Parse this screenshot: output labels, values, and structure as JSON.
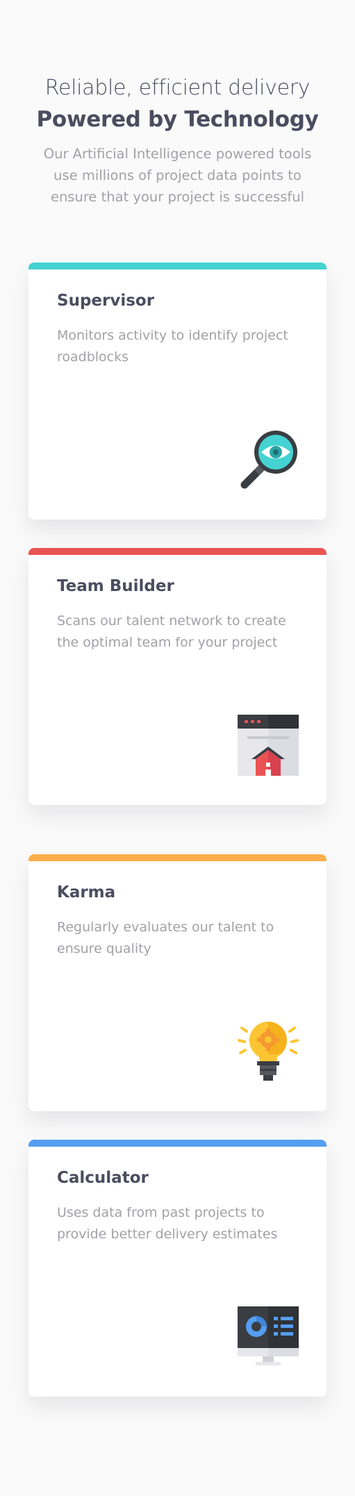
{
  "header": {
    "subtitle": "Reliable, efficient delivery",
    "title": "Powered by Technology",
    "description": "Our Artificial Intelligence powered tools use millions of project data points to ensure that your project is successful"
  },
  "cards": [
    {
      "title": "Supervisor",
      "description": "Monitors activity to identify project roadblocks",
      "accent": "#44d3d2",
      "icon": "magnifier-eye-icon"
    },
    {
      "title": "Team Builder",
      "description": "Scans our talent network to create the optimal team for your project",
      "accent": "#ea5353",
      "icon": "browser-house-icon"
    },
    {
      "title": "Karma",
      "description": "Regularly evaluates our talent to ensure quality",
      "accent": "#fcae4a",
      "icon": "lightbulb-gear-icon"
    },
    {
      "title": "Calculator",
      "description": "Uses data from past projects to provide better delivery estimates",
      "accent": "#549ef2",
      "icon": "monitor-dashboard-icon"
    }
  ]
}
